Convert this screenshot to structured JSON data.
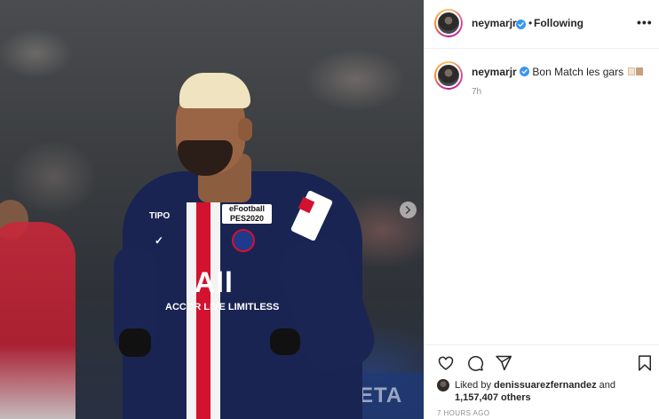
{
  "post": {
    "media": {
      "sponsor_text": "All",
      "sponsor_sub": "ACCOR LIVE LIMITLESS",
      "shirt_badge_text": "eFootball PES2020",
      "board_text": "ONMETA"
    },
    "next_icon": "chevron-right-icon"
  },
  "header": {
    "username": "neymarjr",
    "separator": "•",
    "follow_label": "Following",
    "more_label": "•••"
  },
  "caption": {
    "username": "neymarjr",
    "text": "Bon Match les gars",
    "time": "7h"
  },
  "actions": {
    "icons": [
      "heart-icon",
      "comment-icon",
      "share-icon",
      "bookmark-icon"
    ]
  },
  "likes": {
    "prefix": "Liked by ",
    "user": "denissuarezfernandez",
    "middle": " and ",
    "count": "1,157,407 others"
  },
  "timestamp": "7 HOURS AGO",
  "colors": {
    "verified": "#3897f0",
    "text": "#262626",
    "secondary": "#8e8e8e",
    "border": "#efefef"
  }
}
